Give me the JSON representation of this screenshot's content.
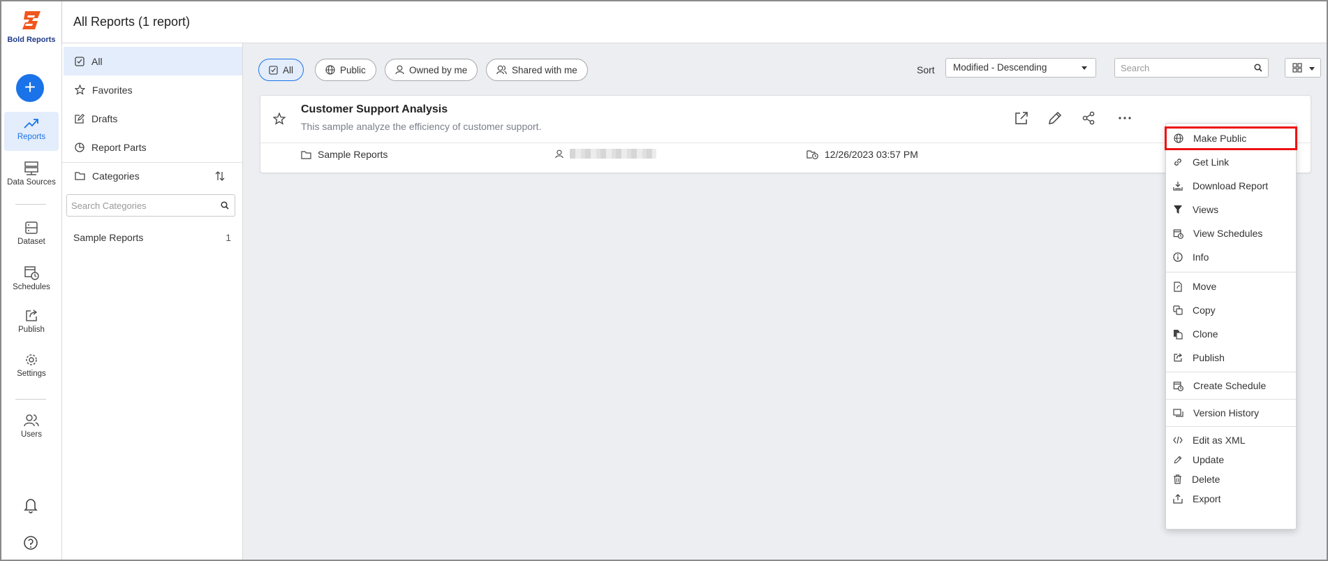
{
  "brand": {
    "name": "Bold Reports",
    "accent": "#1a73e8",
    "logo_color": "#f0561d"
  },
  "header": {
    "title": "All Reports (1 report)"
  },
  "nav": {
    "items": [
      {
        "label": "Reports",
        "icon": "trending-icon"
      },
      {
        "label": "Data Sources",
        "icon": "server-icon"
      },
      {
        "label": "Dataset",
        "icon": "dataset-icon"
      },
      {
        "label": "Schedules",
        "icon": "calendar-clock-icon"
      },
      {
        "label": "Publish",
        "icon": "publish-icon"
      },
      {
        "label": "Settings",
        "icon": "gear-icon"
      },
      {
        "label": "Users",
        "icon": "users-icon"
      }
    ]
  },
  "sidebar": {
    "items": [
      {
        "label": "All",
        "icon": "checkbox-icon"
      },
      {
        "label": "Favorites",
        "icon": "star-icon"
      },
      {
        "label": "Drafts",
        "icon": "edit-icon"
      },
      {
        "label": "Report Parts",
        "icon": "pie-icon"
      }
    ],
    "categories_label": "Categories",
    "search_placeholder": "Search Categories",
    "category_list": [
      {
        "name": "Sample Reports",
        "count": "1"
      }
    ]
  },
  "filters": {
    "pills": [
      {
        "label": "All",
        "icon": "checkbox-icon"
      },
      {
        "label": "Public",
        "icon": "globe-icon"
      },
      {
        "label": "Owned by me",
        "icon": "user-icon"
      },
      {
        "label": "Shared with me",
        "icon": "users-icon"
      }
    ],
    "sort_label": "Sort",
    "sort_value": "Modified - Descending",
    "search_placeholder": "Search"
  },
  "report": {
    "title": "Customer Support Analysis",
    "description": "This sample analyze the efficiency of customer support.",
    "category": "Sample Reports",
    "modified": "12/26/2023 03:57 PM"
  },
  "menu": {
    "items": [
      {
        "label": "Make Public",
        "icon": "globe-icon"
      },
      {
        "label": "Get Link",
        "icon": "link-icon"
      },
      {
        "label": "Download Report",
        "icon": "download-icon"
      },
      {
        "label": "Views",
        "icon": "filter-icon"
      },
      {
        "label": "View Schedules",
        "icon": "calendar-clock-icon"
      },
      {
        "label": "Info",
        "icon": "info-icon"
      },
      {
        "label": "Move",
        "icon": "move-icon"
      },
      {
        "label": "Copy",
        "icon": "copy-icon"
      },
      {
        "label": "Clone",
        "icon": "clone-icon"
      },
      {
        "label": "Publish",
        "icon": "publish-icon"
      },
      {
        "label": "Create Schedule",
        "icon": "calendar-clock-icon"
      },
      {
        "label": "Version History",
        "icon": "history-icon"
      },
      {
        "label": "Edit as XML",
        "icon": "code-icon"
      },
      {
        "label": "Update",
        "icon": "pencil-icon"
      },
      {
        "label": "Delete",
        "icon": "trash-icon"
      },
      {
        "label": "Export",
        "icon": "export-icon"
      }
    ]
  }
}
